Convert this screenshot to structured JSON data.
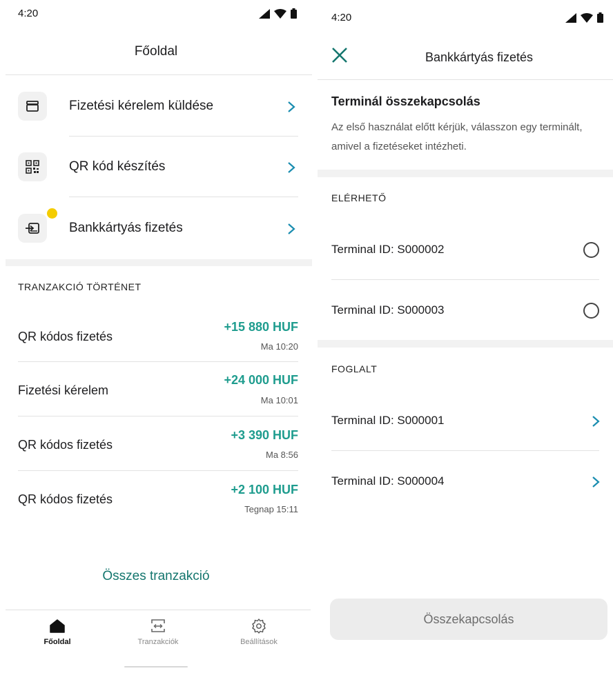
{
  "left": {
    "status_time": "4:20",
    "title": "Főoldal",
    "menu": [
      {
        "icon": "wallet-icon",
        "label": "Fizetési kérelem küldése"
      },
      {
        "icon": "qr-code-icon",
        "label": "QR kód készítés"
      },
      {
        "icon": "card-terminal-icon",
        "label": "Bankkártyás fizetés",
        "notification_dot_color": "#f4cc00"
      }
    ],
    "history_heading": "TRANZAKCIÓ TÖRTÉNET",
    "transactions": [
      {
        "name": "QR kódos fizetés",
        "amount": "+15 880 HUF",
        "time": "Ma 10:20"
      },
      {
        "name": "Fizetési kérelem",
        "amount": "+24 000 HUF",
        "time": "Ma 10:01"
      },
      {
        "name": "QR kódos fizetés",
        "amount": "+3 390 HUF",
        "time": "Ma 8:56"
      },
      {
        "name": "QR kódos fizetés",
        "amount": "+2 100 HUF",
        "time": "Tegnap 15:11"
      }
    ],
    "all_transactions_link": "Összes tranzakció",
    "nav": [
      {
        "icon": "home-icon",
        "label": "Főoldal",
        "active": true
      },
      {
        "icon": "transactions-icon",
        "label": "Tranzakciók",
        "active": false
      },
      {
        "icon": "settings-icon",
        "label": "Beállítások",
        "active": false
      }
    ]
  },
  "right": {
    "status_time": "4:20",
    "title": "Bankkártyás fizetés",
    "heading": "Terminál összekapcsolás",
    "description": "Az első használat előtt kérjük, válasszon egy terminált, amivel a fizetéseket intézheti.",
    "available_heading": "ELÉRHETŐ",
    "available": [
      {
        "label": "Terminal ID: S000002"
      },
      {
        "label": "Terminal ID: S000003"
      }
    ],
    "busy_heading": "FOGLALT",
    "busy": [
      {
        "label": "Terminal ID: S000001"
      },
      {
        "label": "Terminal ID: S000004"
      }
    ],
    "connect_button": "Összekapcsolás"
  },
  "colors": {
    "accent_teal": "#14766e",
    "amount_green": "#1e9c8e",
    "notification_yellow": "#f4cc00"
  }
}
